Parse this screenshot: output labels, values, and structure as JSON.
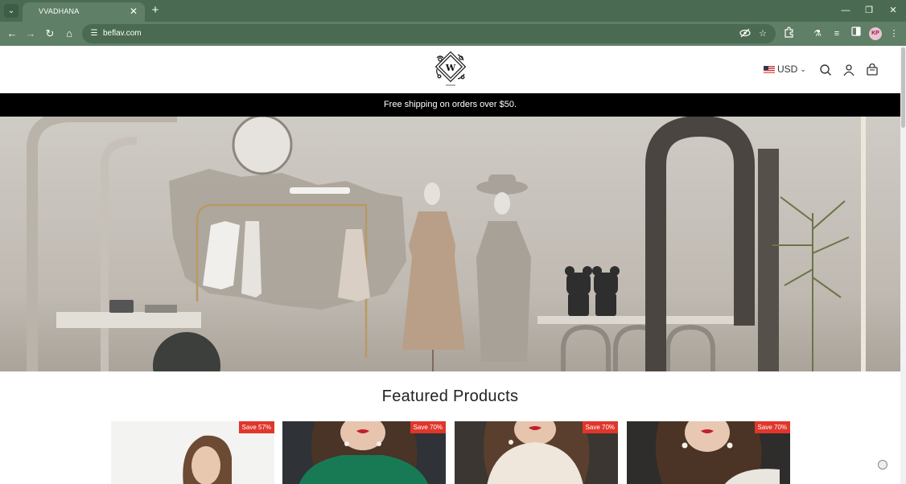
{
  "browser": {
    "tab_title": "VVADHANA",
    "url": "beflav.com",
    "profile_initials": "KP"
  },
  "site": {
    "logo_letter": "W",
    "currency": "USD",
    "announcement": "Free shipping on orders over $50.",
    "featured_title": "Featured Products"
  },
  "products": [
    {
      "badge": "Save 57%"
    },
    {
      "badge": "Save 70%"
    },
    {
      "badge": "Save 70%"
    },
    {
      "badge": "Save 70%"
    }
  ],
  "colors": {
    "browser_frame": "#4a6b52",
    "announcement_bar": "#000000",
    "sale_badge": "#e0362b"
  }
}
